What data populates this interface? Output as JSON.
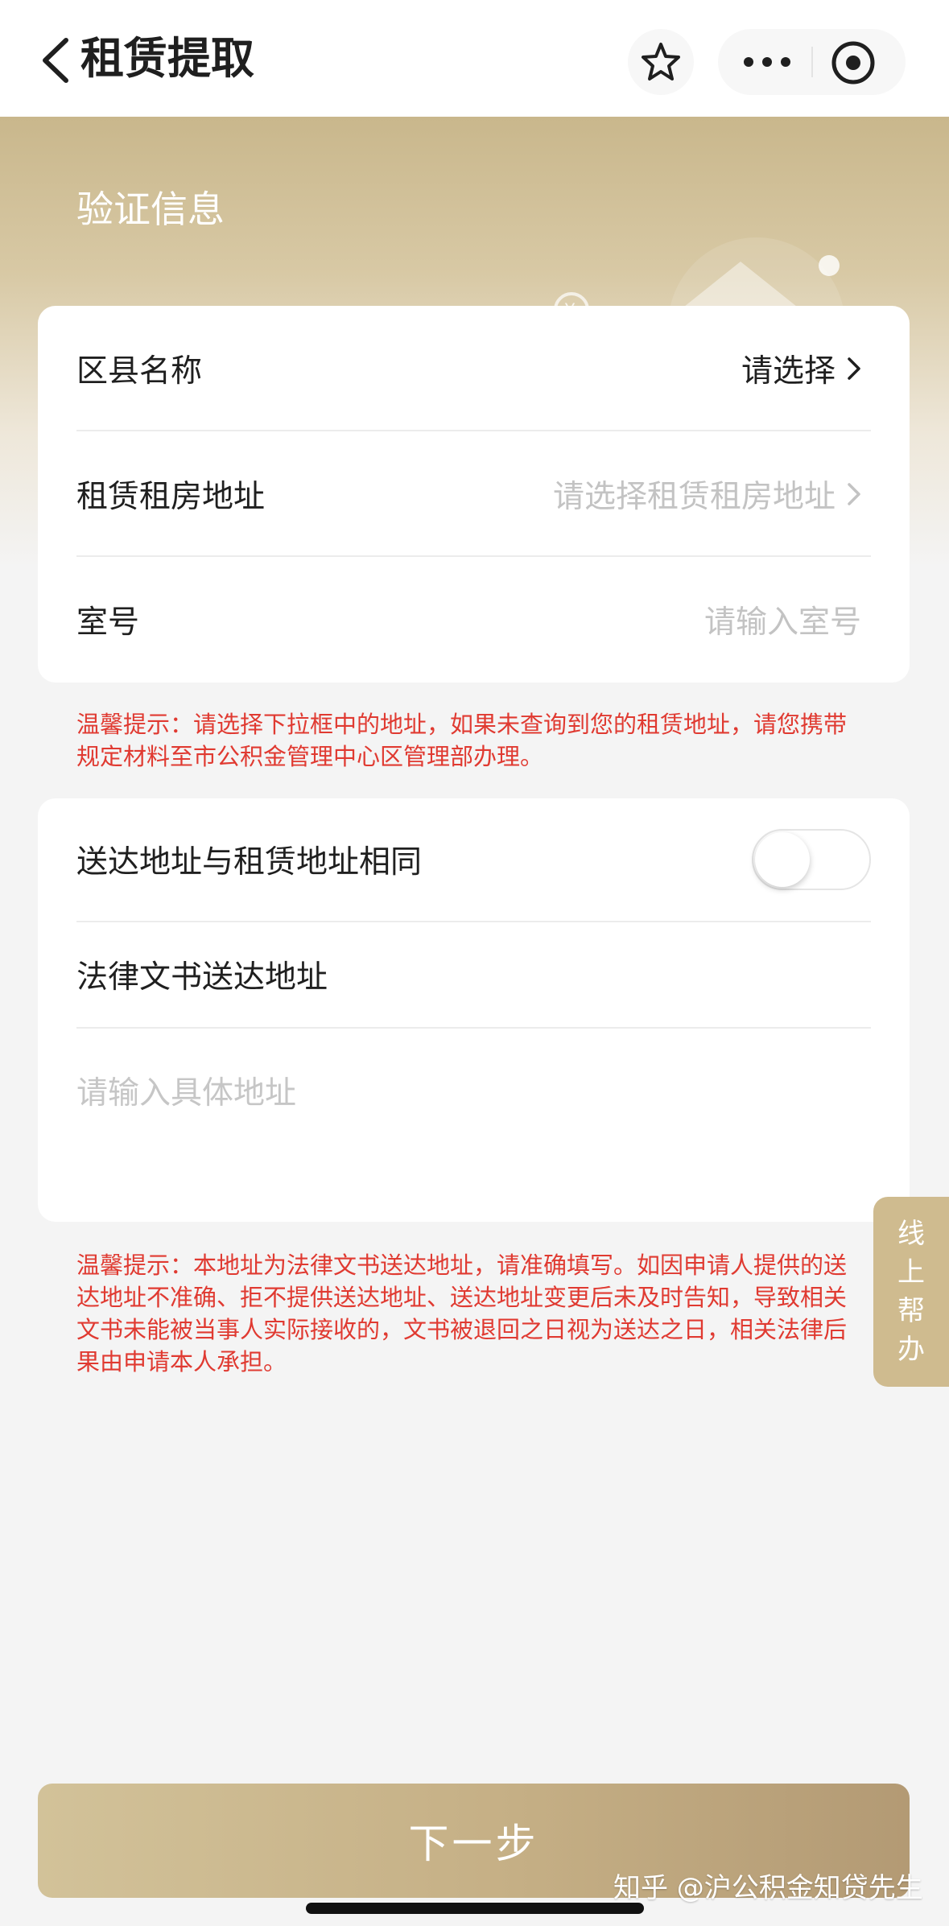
{
  "header": {
    "title": "租赁提取",
    "back_icon": "chevron-left-icon",
    "star_icon": "star-outline-icon",
    "more_icon": "more-dots-icon",
    "target_icon": "target-icon"
  },
  "hero": {
    "label": "验证信息"
  },
  "verify_card": {
    "rows": [
      {
        "label": "区县名称",
        "value": "请选择"
      },
      {
        "label": "租赁租房地址",
        "value": "请选择租赁租房地址"
      },
      {
        "label": "室号",
        "value": "请输入室号"
      }
    ]
  },
  "tip1": "温馨提示：请选择下拉框中的地址，如果未查询到您的租赁地址，请您携带规定材料至市公积金管理中心区管理部办理。",
  "address_card": {
    "same_address_label": "送达地址与租赁地址相同",
    "same_address_on": false,
    "legal_address_label": "法律文书送达地址",
    "legal_address_placeholder": "请输入具体地址"
  },
  "tip2": "温馨提示：本地址为法律文书送达地址，请准确填写。如因申请人提供的送达地址不准确、拒不提供送达地址、送达地址变更后未及时告知，导致相关文书未能被当事人实际接收的，文书被退回之日视为送达之日，相关法律后果由申请本人承担。",
  "side_help": "线上帮办",
  "next_button": "下一步",
  "watermark": "知乎 @沪公积金知贷先生",
  "colors": {
    "accent": "#c5af85",
    "warning": "#e03a31"
  }
}
